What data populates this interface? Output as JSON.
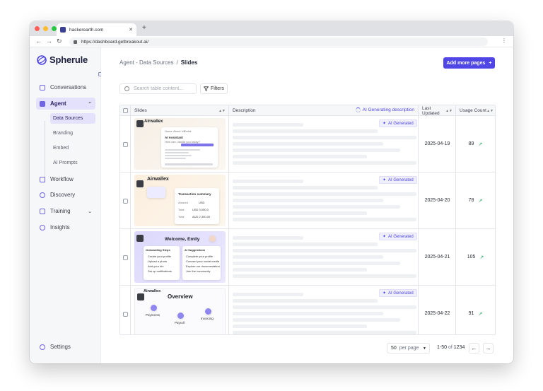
{
  "browser": {
    "tab_title": "hackerearth.com",
    "url": "https://dashboard.getbreakout.ai/"
  },
  "sidebar": {
    "logo": "Spherule",
    "items": [
      {
        "label": "Conversations",
        "icon": "chat-icon"
      },
      {
        "label": "Agent",
        "icon": "robot-icon",
        "active": true
      },
      {
        "label": "Workflow",
        "icon": "workflow-icon"
      },
      {
        "label": "Discovery",
        "icon": "compass-icon"
      },
      {
        "label": "Training",
        "icon": "graduation-cap-icon"
      },
      {
        "label": "Insights",
        "icon": "lightbulb-icon"
      }
    ],
    "agent_sub": [
      "Data Sources",
      "Branding",
      "Embed",
      "AI Prompts"
    ],
    "settings": "Settings"
  },
  "header": {
    "breadcrumb_parent": "Agent - Data Sources",
    "breadcrumb_sep": "/",
    "breadcrumb_current": "Slides",
    "add_button": "Add more pages",
    "add_button_icon": "+"
  },
  "toolbar": {
    "search_placeholder": "Search table content...",
    "filters": "Filters"
  },
  "table": {
    "columns": {
      "slides": "Slides",
      "description": "Description",
      "generating": "AI Generating description",
      "updated": "Last Updated",
      "usage": "Usage Count"
    },
    "ai_badge": "AI Generated",
    "rows": [
      {
        "date": "2025-04-19",
        "usage": "89",
        "thumb": {
          "brand": "Airwallex",
          "title": "AI Assistant",
          "sub": "How can I assist you today?",
          "nav": [
            "Home",
            "About Us",
            "Portal"
          ]
        }
      },
      {
        "date": "2025-04-20",
        "usage": "78",
        "thumb": {
          "brand": "Airwallex",
          "title": "Transaction summary",
          "lines": [
            [
              "Amount",
              "USD"
            ],
            [
              "Total",
              "USD 3,050.0"
            ],
            [
              "Total",
              "AUD 2,300.00"
            ]
          ]
        }
      },
      {
        "date": "2025-04-21",
        "usage": "105",
        "thumb": {
          "title": "Welcome, Emily",
          "left_head": "Onboarding Steps",
          "right_head": "AI Suggestions",
          "left": [
            "Create your profile",
            "Upload a photo",
            "Add your bio",
            "Set up notifications"
          ],
          "right": [
            "Complete your profile",
            "Connect your social media",
            "Explore our documentation",
            "Join the community"
          ]
        }
      },
      {
        "date": "2025-04-22",
        "usage": "91",
        "thumb": {
          "brand": "Airwallex",
          "title": "Overview",
          "nodes": [
            "Payments",
            "Payroll",
            "Invoicing"
          ]
        }
      }
    ]
  },
  "footer": {
    "per_page_value": "50",
    "per_page_label": "per page",
    "range": "1-50",
    "of": "of",
    "total": "1234"
  },
  "colors": {
    "accent": "#4f46e5",
    "active_bg": "#e3e1fb",
    "trend": "#22a55a"
  }
}
